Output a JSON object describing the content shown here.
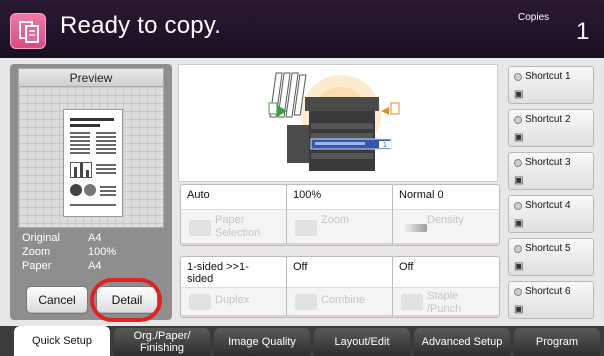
{
  "header": {
    "title": "Ready to copy.",
    "copies_label": "Copies",
    "copies_value": "1"
  },
  "left_panel": {
    "preview_title": "Preview",
    "preview_page_heading": "Printing items from ...",
    "info": [
      {
        "key": "Original",
        "value": "A4"
      },
      {
        "key": "Zoom",
        "value": "100%"
      },
      {
        "key": "Paper",
        "value": "A4"
      }
    ],
    "cancel_label": "Cancel",
    "detail_label": "Detail"
  },
  "settings": [
    {
      "value": "Auto",
      "label": "Paper Selection",
      "icon": "paper-tray-icon"
    },
    {
      "value": "100%",
      "label": "Zoom",
      "icon": "zoom-icon"
    },
    {
      "value": "Normal 0",
      "label": "Density",
      "icon": "density-icon"
    },
    {
      "value": "1-sided >>1-sided",
      "label": "Duplex",
      "icon": "duplex-icon"
    },
    {
      "value": "Off",
      "label": "Combine",
      "icon": "combine-icon"
    },
    {
      "value": "Off",
      "label": "Staple /Punch",
      "icon": "staple-icon"
    }
  ],
  "shortcuts": [
    "Shortcut 1",
    "Shortcut 2",
    "Shortcut 3",
    "Shortcut 4",
    "Shortcut 5",
    "Shortcut 6"
  ],
  "tabs": [
    "Quick Setup",
    "Org./Paper/ Finishing",
    "Image Quality",
    "Layout/Edit",
    "Advanced Setup",
    "Program"
  ],
  "colors": {
    "header": "#1f1328",
    "accent_pink": "#e05a90",
    "highlight_ring": "#e02222"
  }
}
